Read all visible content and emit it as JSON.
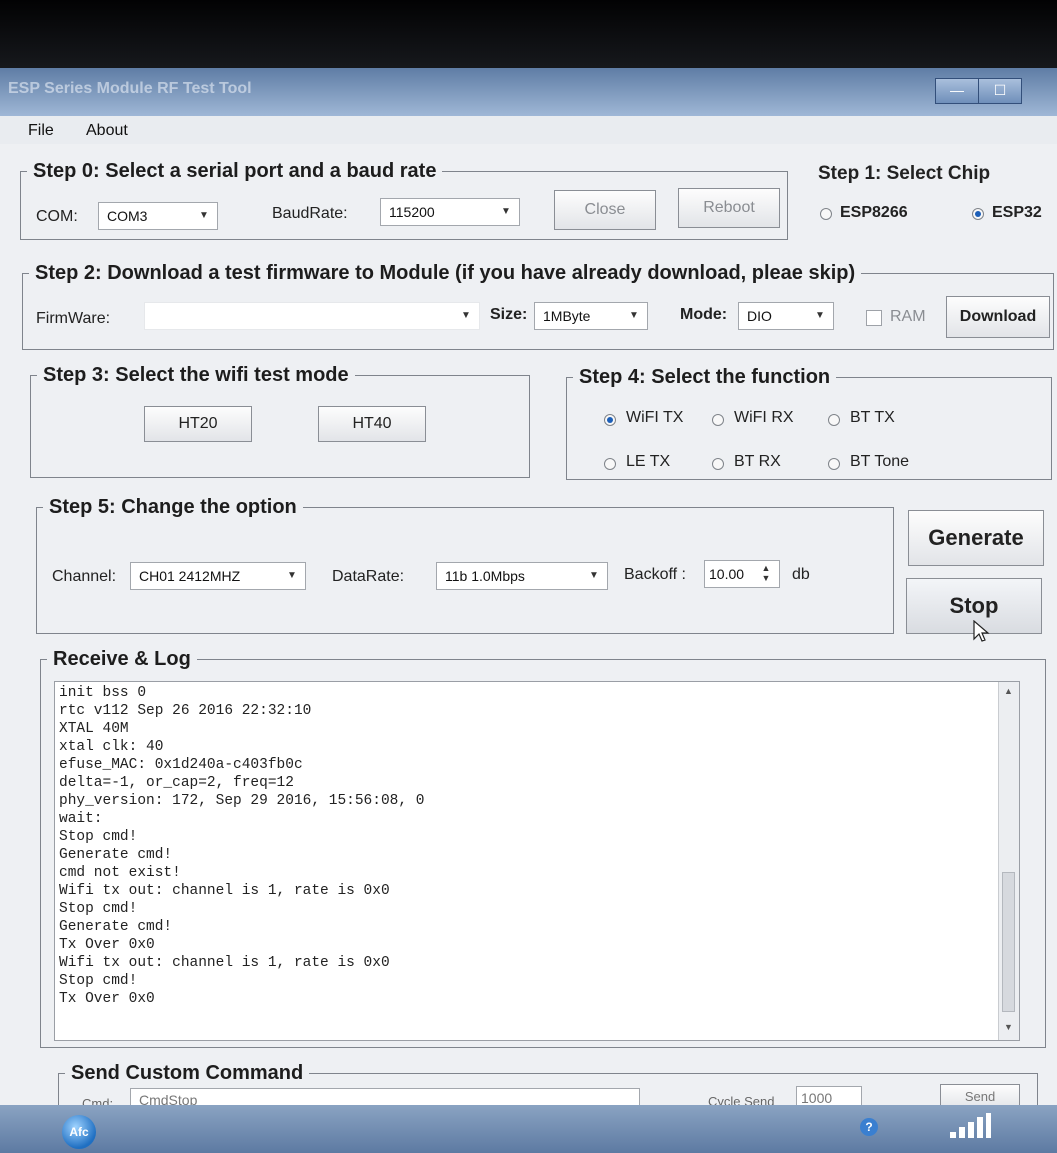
{
  "window": {
    "title": "ESP Series Module RF Test Tool",
    "controls": {
      "minimize": "—",
      "maximize": "☐"
    }
  },
  "menu": {
    "file": "File",
    "about": "About"
  },
  "step0": {
    "title": "Step 0: Select a serial port and a baud rate",
    "com_label": "COM:",
    "com_value": "COM3",
    "baud_label": "BaudRate:",
    "baud_value": "115200",
    "close_button": "Close",
    "reboot_button": "Reboot"
  },
  "step1": {
    "title": "Step 1: Select Chip",
    "chips": [
      {
        "label": "ESP8266",
        "selected": false
      },
      {
        "label": "ESP32",
        "selected": true
      }
    ]
  },
  "step2": {
    "title": "Step 2: Download a test firmware to Module  (if you have already download, pleae skip)",
    "firmware_label": "FirmWare:",
    "firmware_value": "",
    "size_label": "Size:",
    "size_value": "1MByte",
    "mode_label": "Mode:",
    "mode_value": "DIO",
    "ram_label": "RAM",
    "ram_checked": false,
    "download_button": "Download"
  },
  "step3": {
    "title": "Step 3: Select the wifi test mode",
    "ht20_button": "HT20",
    "ht40_button": "HT40"
  },
  "step4": {
    "title": "Step 4: Select the function",
    "functions": [
      {
        "label": "WiFI TX",
        "selected": true
      },
      {
        "label": "WiFI RX",
        "selected": false
      },
      {
        "label": "BT TX",
        "selected": false
      },
      {
        "label": "LE TX",
        "selected": false
      },
      {
        "label": "BT RX",
        "selected": false
      },
      {
        "label": "BT Tone",
        "selected": false
      }
    ]
  },
  "step5": {
    "title": "Step 5: Change the option",
    "channel_label": "Channel:",
    "channel_value": "CH01 2412MHZ",
    "datarate_label": "DataRate:",
    "datarate_value": "11b 1.0Mbps",
    "backoff_label": "Backoff :",
    "backoff_value": "10.00",
    "backoff_unit": "db"
  },
  "actions": {
    "generate_button": "Generate",
    "stop_button": "Stop"
  },
  "log": {
    "title": "Receive & Log",
    "lines": [
      "init bss 0",
      "rtc v112 Sep 26 2016 22:32:10",
      "XTAL 40M",
      "xtal clk: 40",
      "efuse_MAC: 0x1d240a-c403fb0c",
      "delta=-1, or_cap=2, freq=12",
      "phy_version: 172, Sep 29 2016, 15:56:08, 0",
      "wait:",
      "Stop cmd!",
      "Generate cmd!",
      "cmd not exist!",
      "Wifi tx out: channel is 1, rate is 0x0",
      "Stop cmd!",
      "Generate cmd!",
      "Tx Over 0x0",
      "Wifi tx out: channel is 1, rate is 0x0",
      "Stop cmd!",
      "Tx Over 0x0"
    ]
  },
  "custom": {
    "title": "Send Custom Command",
    "cmd_label": "Cmd:",
    "cmd_value": "CmdStop",
    "cycle_label": "Cycle Send",
    "cycle_value": "1000",
    "send_button": "Send"
  },
  "taskbar": {
    "start_label": "Afc"
  }
}
